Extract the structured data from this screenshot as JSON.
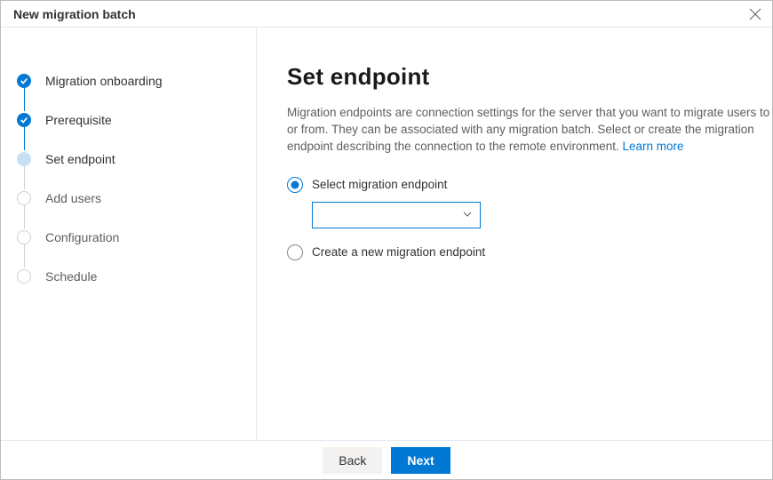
{
  "header": {
    "title": "New migration batch"
  },
  "steps": [
    {
      "label": "Migration onboarding",
      "state": "done"
    },
    {
      "label": "Prerequisite",
      "state": "done"
    },
    {
      "label": "Set endpoint",
      "state": "current"
    },
    {
      "label": "Add users",
      "state": "upcoming"
    },
    {
      "label": "Configuration",
      "state": "upcoming"
    },
    {
      "label": "Schedule",
      "state": "upcoming"
    }
  ],
  "main": {
    "title": "Set endpoint",
    "description": "Migration endpoints are connection settings for the server that you want to migrate users to or from. They can be associated with any migration batch. Select or create the migration endpoint describing the connection to the remote environment. ",
    "learn_more": "Learn more",
    "options": {
      "select_label": "Select migration endpoint",
      "create_label": "Create a new migration endpoint",
      "selected": "select",
      "dropdown_value": ""
    }
  },
  "footer": {
    "back": "Back",
    "next": "Next"
  }
}
